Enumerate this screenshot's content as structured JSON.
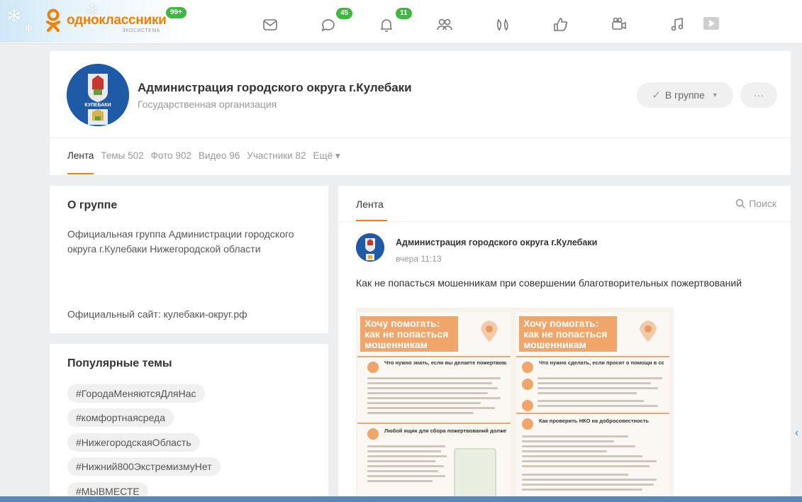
{
  "header": {
    "logo_name": "одноклассники",
    "logo_sub": "ЭКОСИСТЕМА",
    "logo_badge": "99+",
    "nav": [
      {
        "icon": "mail-icon"
      },
      {
        "icon": "discussions-icon",
        "badge": "45"
      },
      {
        "icon": "notifications-icon",
        "badge": "11"
      },
      {
        "icon": "friends-icon"
      },
      {
        "icon": "guests-icon"
      },
      {
        "icon": "likes-icon"
      },
      {
        "icon": "video-icon"
      },
      {
        "icon": "music-icon"
      },
      {
        "icon": "play-icon"
      }
    ]
  },
  "group": {
    "title": "Администрация городского округа г.Кулебаки",
    "subtitle": "Государственная организация",
    "avatar_label": "КУЛЕБАКИ",
    "in_group_label": "В группе",
    "more_label": "···",
    "tabs": [
      {
        "label": "Лента",
        "count": ""
      },
      {
        "label": "Темы",
        "count": "502"
      },
      {
        "label": "Фото",
        "count": "902"
      },
      {
        "label": "Видео",
        "count": "96"
      },
      {
        "label": "Участники",
        "count": "82"
      },
      {
        "label": "Ещё ▾",
        "count": ""
      }
    ]
  },
  "about": {
    "title": "О группе",
    "description": "Официальная группа Администрации городского округа г.Кулебаки Нижегородской области",
    "site_prefix": "Официальный сайт:",
    "site_link": "кулебаки-округ.рф"
  },
  "topics": {
    "title": "Популярные темы",
    "tags": [
      "#ГородаМеняютсяДляНас",
      "#комфортнаясреда",
      "#НижегородскаяОбласть",
      "#Нижний800ЭкстремизмуНет",
      "#МЫВМЕСТЕ"
    ]
  },
  "feed": {
    "tab_label": "Лента",
    "search_label": "Поиск",
    "post": {
      "author": "Администрация городского округа г.Кулебаки",
      "time": "вчера 11:13",
      "text": "Как не попасться мошенникам при совершении благотворительных пожертвований",
      "poster_left_title": "Хочу помогать: как не попасться мошенникам",
      "poster_right_title": "Хочу помогать: как не попасться мошенникам",
      "poster_left_section1": "Что нужно знать, если вы делаете пожертвования в ящик для сбора пожертвований:",
      "poster_left_section2": "Любой ящик для сбора пожертвований должен содержать:",
      "poster_right_section1": "Что нужно сделать, если просят о помощи в соцсетях или по email:",
      "poster_right_section2": "Как проверить НКО на добросовестность"
    }
  },
  "colors": {
    "brand_orange": "#ee8208",
    "badge_green": "#3fb83f",
    "poster_orange": "#f0a56b",
    "avatar_blue": "#1f5aa6"
  }
}
